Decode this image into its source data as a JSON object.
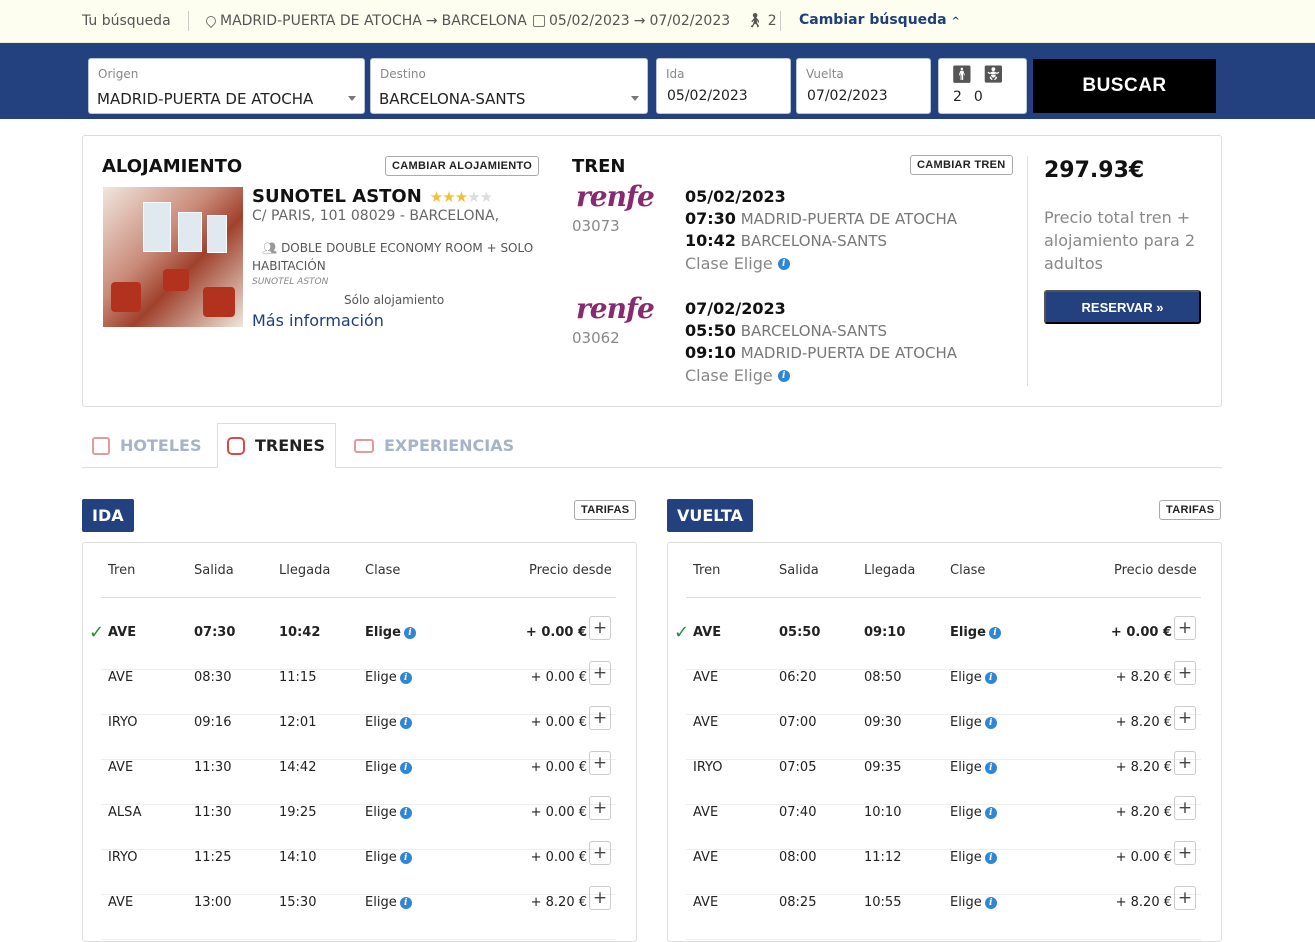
{
  "topbar": {
    "label": "Tu búsqueda",
    "origin": "MADRID-PUERTA DE ATOCHA",
    "arrow": "→",
    "destination": "BARCELONA",
    "date_out": "05/02/2023",
    "date_ret": "07/02/2023",
    "pax": "2",
    "change": "Cambiar búsqueda"
  },
  "search": {
    "origin_label": "Origen",
    "origin_value": "MADRID-PUERTA DE ATOCHA",
    "dest_label": "Destino",
    "dest_value": "BARCELONA-SANTS",
    "ida_label": "Ida",
    "ida_value": "05/02/2023",
    "vuelta_label": "Vuelta",
    "vuelta_value": "07/02/2023",
    "adults": "2",
    "children": "0",
    "button": "BUSCAR"
  },
  "summary": {
    "accom_title": "ALOJAMIENTO",
    "accom_change": "CAMBIAR ALOJAMIENTO",
    "hotel_name": "SUNOTEL ASTON",
    "hotel_stars": 3,
    "hotel_address": "C/ PARIS, 101 08029 - BARCELONA,",
    "room": "DOBLE DOUBLE ECONOMY ROOM + SOLO HABITACIÓN",
    "hotel_sub": "SUNOTEL ASTON",
    "regime": "Sólo alojamiento",
    "more_info": "Más información",
    "train_title": "TREN",
    "train_change": "CAMBIAR TREN",
    "operator_logo": "renfe",
    "outbound": {
      "number": "03073",
      "date": "05/02/2023",
      "dep_time": "07:30",
      "dep_station": "MADRID-PUERTA DE ATOCHA",
      "arr_time": "10:42",
      "arr_station": "BARCELONA-SANTS",
      "class": "Clase Elige"
    },
    "inbound": {
      "number": "03062",
      "date": "07/02/2023",
      "dep_time": "05:50",
      "dep_station": "BARCELONA-SANTS",
      "arr_time": "09:10",
      "arr_station": "MADRID-PUERTA DE ATOCHA",
      "class": "Clase Elige"
    },
    "total_price": "297.93€",
    "price_desc": "Precio total tren + alojamiento para 2 adultos",
    "book_button": "RESERVAR »"
  },
  "tabs": [
    {
      "label": "HOTELES",
      "icon": "hotel-icon"
    },
    {
      "label": "TRENES",
      "icon": "train-icon"
    },
    {
      "label": "EXPERIENCIAS",
      "icon": "ticket-icon"
    }
  ],
  "ida": {
    "badge": "IDA",
    "tarifas": "TARIFAS",
    "headers": {
      "tren": "Tren",
      "salida": "Salida",
      "llegada": "Llegada",
      "clase": "Clase",
      "precio": "Precio desde"
    },
    "rows": [
      {
        "tren": "AVE",
        "salida": "07:30",
        "llegada": "10:42",
        "clase": "Elige",
        "precio": "+ 0.00 €",
        "selected": true
      },
      {
        "tren": "AVE",
        "salida": "08:30",
        "llegada": "11:15",
        "clase": "Elige",
        "precio": "+ 0.00 €",
        "selected": false
      },
      {
        "tren": "IRYO",
        "salida": "09:16",
        "llegada": "12:01",
        "clase": "Elige",
        "precio": "+ 0.00 €",
        "selected": false
      },
      {
        "tren": "AVE",
        "salida": "11:30",
        "llegada": "14:42",
        "clase": "Elige",
        "precio": "+ 0.00 €",
        "selected": false
      },
      {
        "tren": "ALSA",
        "salida": "11:30",
        "llegada": "19:25",
        "clase": "Elige",
        "precio": "+ 0.00 €",
        "selected": false
      },
      {
        "tren": "IRYO",
        "salida": "11:25",
        "llegada": "14:10",
        "clase": "Elige",
        "precio": "+ 0.00 €",
        "selected": false
      },
      {
        "tren": "AVE",
        "salida": "13:00",
        "llegada": "15:30",
        "clase": "Elige",
        "precio": "+ 8.20 €",
        "selected": false
      }
    ]
  },
  "vuelta": {
    "badge": "VUELTA",
    "tarifas": "TARIFAS",
    "headers": {
      "tren": "Tren",
      "salida": "Salida",
      "llegada": "Llegada",
      "clase": "Clase",
      "precio": "Precio desde"
    },
    "rows": [
      {
        "tren": "AVE",
        "salida": "05:50",
        "llegada": "09:10",
        "clase": "Elige",
        "precio": "+ 0.00 €",
        "selected": true
      },
      {
        "tren": "AVE",
        "salida": "06:20",
        "llegada": "08:50",
        "clase": "Elige",
        "precio": "+ 8.20 €",
        "selected": false
      },
      {
        "tren": "AVE",
        "salida": "07:00",
        "llegada": "09:30",
        "clase": "Elige",
        "precio": "+ 8.20 €",
        "selected": false
      },
      {
        "tren": "IRYO",
        "salida": "07:05",
        "llegada": "09:35",
        "clase": "Elige",
        "precio": "+ 8.20 €",
        "selected": false
      },
      {
        "tren": "AVE",
        "salida": "07:40",
        "llegada": "10:10",
        "clase": "Elige",
        "precio": "+ 8.20 €",
        "selected": false
      },
      {
        "tren": "AVE",
        "salida": "08:00",
        "llegada": "11:12",
        "clase": "Elige",
        "precio": "+ 0.00 €",
        "selected": false
      },
      {
        "tren": "AVE",
        "salida": "08:25",
        "llegada": "10:55",
        "clase": "Elige",
        "precio": "+ 8.20 €",
        "selected": false
      }
    ]
  },
  "colors": {
    "brand": "#22417e",
    "accent_link": "#1f3f7a",
    "renfe": "#8a2a6e",
    "check": "#2b8a3e"
  }
}
